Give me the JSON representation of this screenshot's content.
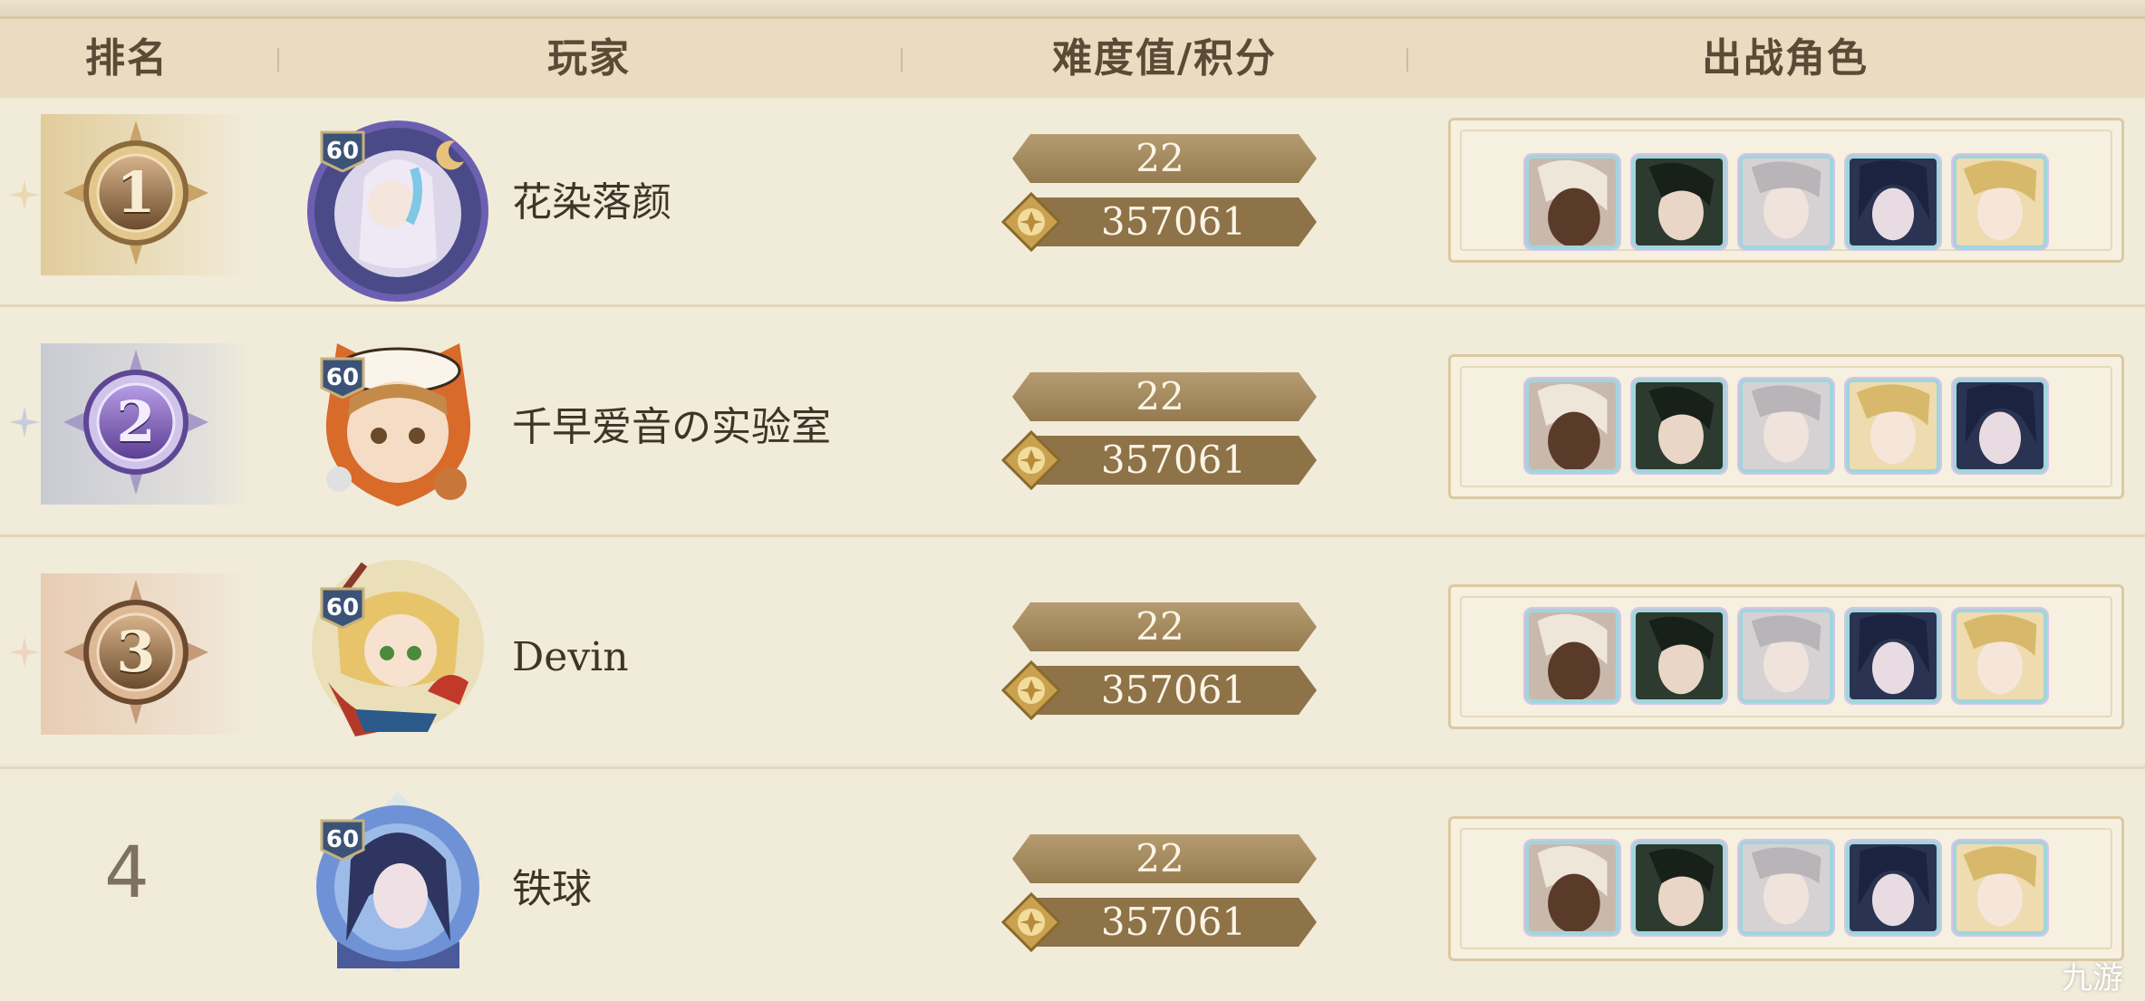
{
  "header": {
    "rank": "排名",
    "player": "玩家",
    "difficulty_score": "难度值/积分",
    "team": "出战角色"
  },
  "rows": [
    {
      "rank": "1",
      "player_name": "花染落颜",
      "level": "60",
      "difficulty": "22",
      "score": "357061",
      "team": [
        "dark-skinned-hero-icon",
        "black-haired-hero-icon",
        "silver-haired-hero-icon",
        "navy-haired-hero-icon",
        "blond-hero-icon"
      ]
    },
    {
      "rank": "2",
      "player_name": "千早爱音の实验室",
      "level": "60",
      "difficulty": "22",
      "score": "357061",
      "team": [
        "dark-skinned-hero-icon",
        "black-haired-hero-icon",
        "silver-haired-hero-icon",
        "blond-hero-icon",
        "navy-haired-hero-icon"
      ]
    },
    {
      "rank": "3",
      "player_name": "Devin",
      "level": "60",
      "difficulty": "22",
      "score": "357061",
      "team": [
        "dark-skinned-hero-icon",
        "black-haired-hero-icon",
        "silver-haired-hero-icon",
        "navy-haired-hero-icon",
        "blond-hero-icon"
      ]
    },
    {
      "rank": "4",
      "player_name": "铁球",
      "level": "60",
      "difficulty": "22",
      "score": "357061",
      "team": [
        "dark-skinned-hero-icon",
        "black-haired-hero-icon",
        "silver-haired-hero-icon",
        "navy-haired-hero-icon",
        "blond-hero-icon"
      ]
    }
  ],
  "watermark": "九游",
  "colors": {
    "gold": "#8b6a3d",
    "pill": "#a78d62",
    "silver_medal": "#7e5fb3",
    "bronze_medal": "#6b4a30"
  }
}
